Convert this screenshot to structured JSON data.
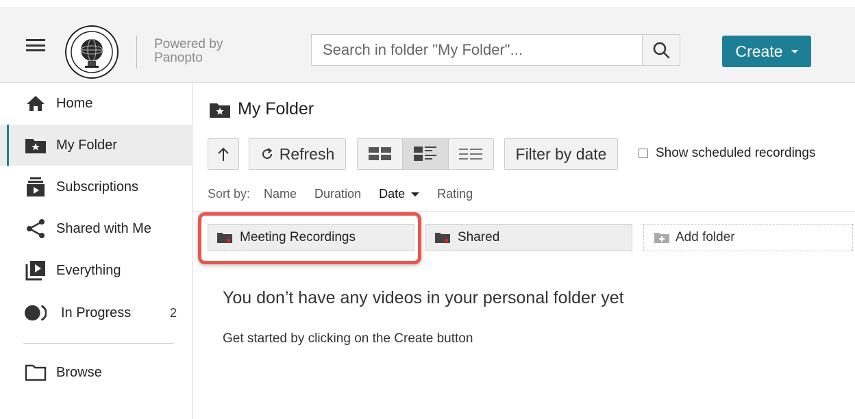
{
  "header": {
    "logo_icon": "university-seal-icon",
    "powered_by_line1": "Powered by",
    "powered_by_line2": "Panopto",
    "search_placeholder": "Search in folder \"My Folder\"...",
    "create_label": "Create",
    "accent_color": "#1d7f96"
  },
  "sidebar": {
    "items": [
      {
        "label": "Home",
        "icon": "home-icon",
        "active": false
      },
      {
        "label": "My Folder",
        "icon": "folder-star-icon",
        "active": true
      },
      {
        "label": "Subscriptions",
        "icon": "subscriptions-icon",
        "active": false
      },
      {
        "label": "Shared with Me",
        "icon": "share-icon",
        "active": false
      },
      {
        "label": "Everything",
        "icon": "video-library-icon",
        "active": false
      },
      {
        "label": "In Progress",
        "icon": "in-progress-icon",
        "active": false,
        "count": "2"
      },
      {
        "label": "Browse",
        "icon": "folder-outline-icon",
        "active": false
      }
    ]
  },
  "main": {
    "title": "My Folder",
    "toolbar": {
      "refresh_label": "Refresh",
      "filter_label": "Filter by date",
      "scheduled_label": "Show scheduled recordings",
      "selected_view": "detail"
    },
    "sort": {
      "label": "Sort by:",
      "options": [
        "Name",
        "Duration",
        "Date",
        "Rating"
      ],
      "active": "Date"
    },
    "folders": [
      "Meeting Recordings",
      "Shared"
    ],
    "add_folder_label": "Add folder",
    "highlight_color": "#e7574f",
    "empty_title": "You don’t have any videos in your personal folder yet",
    "empty_subtitle": "Get started by clicking on the Create button"
  }
}
